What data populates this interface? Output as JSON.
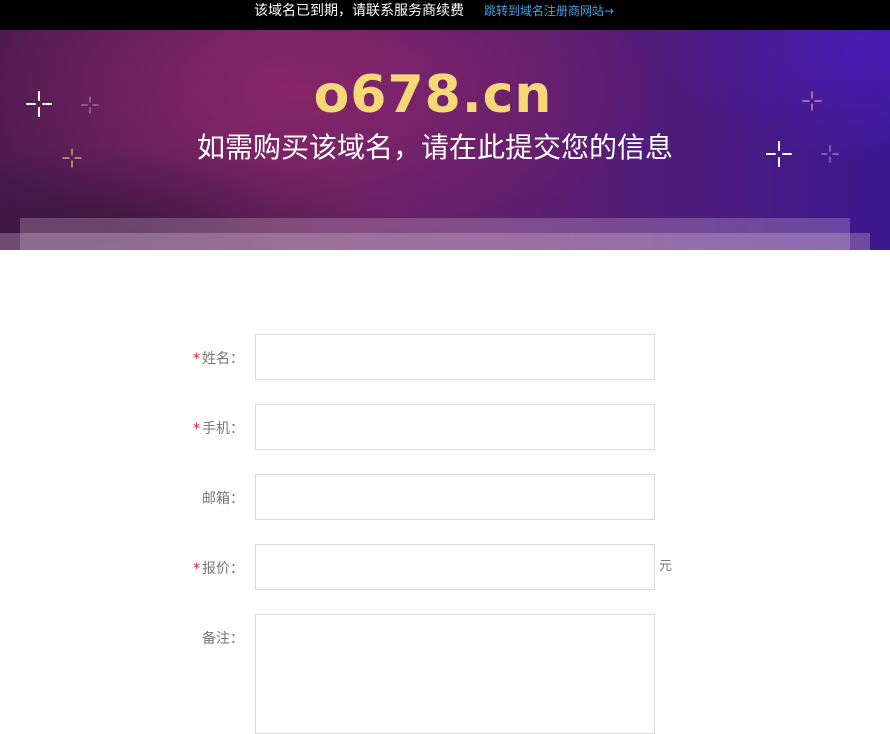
{
  "topbar": {
    "notice": "该域名已到期，请联系服务商续费",
    "jump_link": "跳转到域名注册商网站→"
  },
  "hero": {
    "domain": "o678.cn",
    "subtitle": "如需购买该域名，请在此提交您的信息"
  },
  "form": {
    "required_mark": "*",
    "name_label": "姓名：",
    "phone_label": "手机：",
    "email_label": "邮箱：",
    "price_label": "报价：",
    "price_unit": "元",
    "note_label": "备注："
  },
  "colors": {
    "title": "#f5d877",
    "link": "#3fa4e6",
    "required": "#e02020"
  },
  "icons": [
    "sparkle-icon"
  ]
}
